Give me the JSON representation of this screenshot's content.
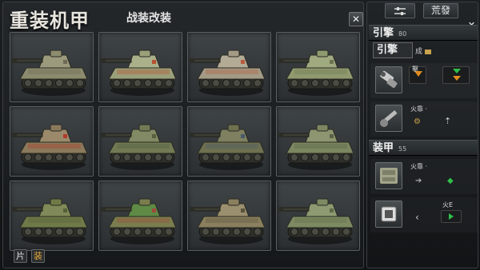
{
  "header": {
    "title": "重装机甲",
    "subtitle": "战装改装",
    "close_label": "✕"
  },
  "grid": {
    "tanks": [
      {
        "name": "tank-1",
        "hull": "#8c8b6e",
        "turret": "#9c9a7c",
        "accent": "#6d6b55"
      },
      {
        "name": "tank-2",
        "hull": "#9aa079",
        "turret": "#aab08a",
        "accent": "#b65030"
      },
      {
        "name": "tank-3",
        "hull": "#a39b85",
        "turret": "#b3ab96",
        "accent": "#b85a3e"
      },
      {
        "name": "tank-4",
        "hull": "#8f9b6f",
        "turret": "#a0aa80",
        "accent": "#6c7552"
      },
      {
        "name": "tank-5",
        "hull": "#8a7a5b",
        "turret": "#9a8a6b",
        "accent": "#b03a2c"
      },
      {
        "name": "tank-6",
        "hull": "#717a54",
        "turret": "#818a64",
        "accent": "#565e3e"
      },
      {
        "name": "tank-7",
        "hull": "#6e7050",
        "turret": "#7e8060",
        "accent": "#4a5a6b"
      },
      {
        "name": "tank-8",
        "hull": "#7c8660",
        "turret": "#8c9670",
        "accent": "#5a6348"
      },
      {
        "name": "tank-9",
        "hull": "#6f7a48",
        "turret": "#7f8a58",
        "accent": "#54603a"
      },
      {
        "name": "tank-10",
        "hull": "#7a7d4e",
        "turret": "#5e8a45",
        "accent": "#a04a3a"
      },
      {
        "name": "tank-11",
        "hull": "#8a7f5e",
        "turret": "#9a8f6e",
        "accent": "#5a523c"
      },
      {
        "name": "tank-12",
        "hull": "#7d8a62",
        "turret": "#8d9a72",
        "accent": "#5e6a48"
      }
    ]
  },
  "bottom_buttons": [
    {
      "label": "片"
    },
    {
      "label": "装"
    }
  ],
  "right_panel": {
    "tab_icon": "sliders-icon",
    "tab_label": "荒發",
    "close_label": "✕",
    "engine": {
      "heading": "引擎",
      "heading_small": "80",
      "subhead": "引擎",
      "subhead_tag": "成",
      "row1_label": "擊",
      "row2_label": "火靠 ·"
    },
    "armor": {
      "heading": "装甲",
      "heading_small": "55",
      "row1_label": "火靠 ·",
      "row2_label": "火E"
    },
    "colors": {
      "green": "#2fbf4a",
      "orange": "#e08a1e",
      "gold": "#c9a24d"
    }
  }
}
